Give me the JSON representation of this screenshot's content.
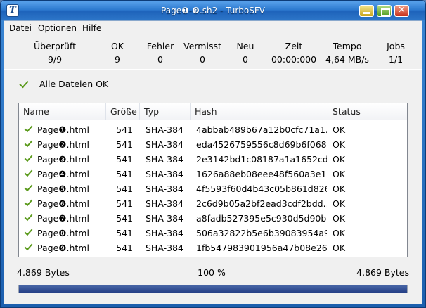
{
  "window": {
    "title": "Page❶-❾.sh2 - TurboSFV",
    "app_icon_letter": "T"
  },
  "menu": {
    "items": [
      "Datei",
      "Optionen",
      "Hilfe"
    ]
  },
  "stats": [
    {
      "label": "Überprüft",
      "value": "9/9"
    },
    {
      "label": "OK",
      "value": "9"
    },
    {
      "label": "Fehler",
      "value": "0"
    },
    {
      "label": "Vermisst",
      "value": "0"
    },
    {
      "label": "Neu",
      "value": "0"
    },
    {
      "label": "Zeit",
      "value": "00:00:000"
    },
    {
      "label": "Tempo",
      "value": "4,64 MB/s"
    },
    {
      "label": "Jobs",
      "value": "1/1"
    }
  ],
  "summary": {
    "text": "Alle Dateien OK"
  },
  "table": {
    "columns": [
      "Name",
      "Größe",
      "Typ",
      "Hash",
      "Status"
    ],
    "rows": [
      {
        "name": "Page❶.html",
        "size": "541",
        "type": "SHA-384",
        "hash": "4abbab489b67a12b0cfc71a1...",
        "status": "OK"
      },
      {
        "name": "Page❷.html",
        "size": "541",
        "type": "SHA-384",
        "hash": "eda4526759556c8d69b6f068...",
        "status": "OK"
      },
      {
        "name": "Page❸.html",
        "size": "541",
        "type": "SHA-384",
        "hash": "2e3142bd1c08187a1a1652cd...",
        "status": "OK"
      },
      {
        "name": "Page❹.html",
        "size": "541",
        "type": "SHA-384",
        "hash": "1626a88eb08eee48f560a3e1a...",
        "status": "OK"
      },
      {
        "name": "Page❺.html",
        "size": "541",
        "type": "SHA-384",
        "hash": "4f5593f60d4b43c05b861d826...",
        "status": "OK"
      },
      {
        "name": "Page❻.html",
        "size": "541",
        "type": "SHA-384",
        "hash": "2c6d9b05a2bf2ead3cdf2bdd...",
        "status": "OK"
      },
      {
        "name": "Page❼.html",
        "size": "541",
        "type": "SHA-384",
        "hash": "a8fadb527395e5c930d5d90b...",
        "status": "OK"
      },
      {
        "name": "Page❽.html",
        "size": "541",
        "type": "SHA-384",
        "hash": "506a32822b5e6b39083954a9...",
        "status": "OK"
      },
      {
        "name": "Page❾.html",
        "size": "541",
        "type": "SHA-384",
        "hash": "1fb547983901956a47b08e26...",
        "status": "OK"
      }
    ]
  },
  "footer": {
    "left": "4.869 Bytes",
    "center": "100 %",
    "right": "4.869 Bytes"
  },
  "progress": {
    "percent": 100
  },
  "colors": {
    "accent": "#2e7bd0",
    "check": "#5b9a1c",
    "progress": "#2b4a91"
  }
}
